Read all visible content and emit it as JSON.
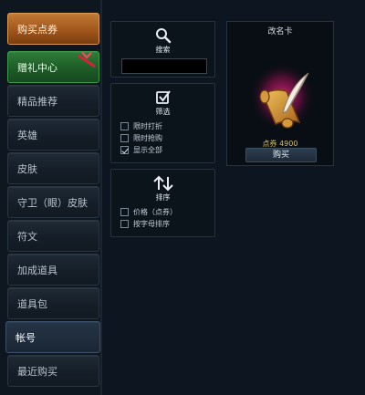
{
  "sidebar": {
    "items": [
      {
        "label": "购买点券"
      },
      {
        "label": "赠礼中心"
      },
      {
        "label": "精品推荐"
      },
      {
        "label": "英雄"
      },
      {
        "label": "皮肤"
      },
      {
        "label": "守卫（眼）皮肤"
      },
      {
        "label": "符文"
      },
      {
        "label": "加成道具"
      },
      {
        "label": "道具包"
      },
      {
        "label": "帐号"
      },
      {
        "label": "最近购买"
      }
    ],
    "active_index": 9
  },
  "search_panel": {
    "title": "搜索",
    "icon": "magnifier-icon",
    "input_value": ""
  },
  "filter_panel": {
    "title": "筛选",
    "icon": "checkbox-icon",
    "options": [
      {
        "label": "限时打折",
        "checked": false
      },
      {
        "label": "限时抢购",
        "checked": false
      },
      {
        "label": "显示全部",
        "checked": true
      }
    ]
  },
  "sort_panel": {
    "title": "排序",
    "icon": "up-down-arrows-icon",
    "options": [
      {
        "label": "价格（点券）",
        "checked": false
      },
      {
        "label": "按字母排序",
        "checked": false
      }
    ]
  },
  "item_card": {
    "title": "改名卡",
    "icon": "scroll-quill-icon",
    "price": "点券 4900",
    "buy_label": "购买"
  },
  "colors": {
    "buy_button": "#a2561b",
    "gift_button": "#1e5c28",
    "price_text": "#d8c06a"
  }
}
